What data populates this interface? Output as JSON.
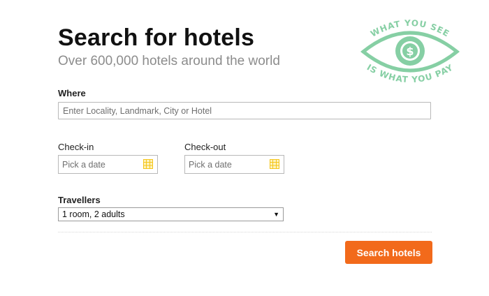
{
  "header": {
    "title": "Search for hotels",
    "subtitle": "Over 600,000 hotels around the world"
  },
  "badge": {
    "top_text": "WHAT YOU SEE",
    "bottom_text": "IS WHAT YOU PAY",
    "icon": "eye-dollar-icon",
    "color": "#86cfa4"
  },
  "form": {
    "where": {
      "label": "Where",
      "placeholder": "Enter Locality, Landmark, City or Hotel",
      "value": ""
    },
    "checkin": {
      "label": "Check-in",
      "placeholder": "Pick a date",
      "icon": "calendar-icon"
    },
    "checkout": {
      "label": "Check-out",
      "placeholder": "Pick a date",
      "icon": "calendar-icon"
    },
    "travellers": {
      "label": "Travellers",
      "selected": "1 room, 2 adults",
      "arrow": "▼"
    },
    "submit_label": "Search hotels"
  },
  "colors": {
    "accent": "#f26a1b",
    "calendar": "#f5c518",
    "subtitle": "#8c8c8c"
  }
}
